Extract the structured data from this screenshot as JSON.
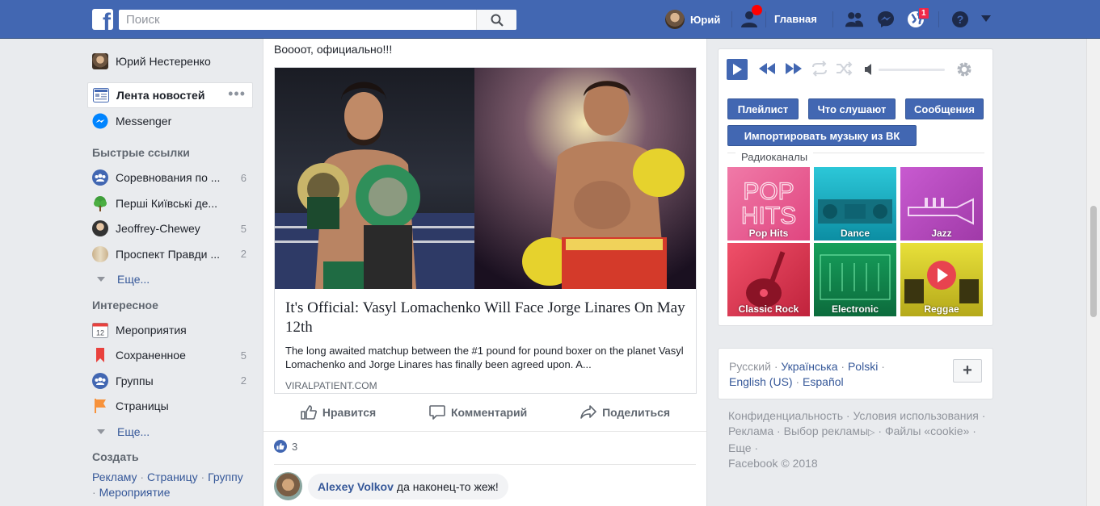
{
  "topbar": {
    "search_placeholder": "Поиск",
    "user_name": "Юрий",
    "home_label": "Главная",
    "notifications_count": "1",
    "brand_color": "#4267b2"
  },
  "leftnav": {
    "profile_name": "Юрий Нестеренко",
    "main_items": [
      {
        "label": "Лента новостей",
        "icon": "news-feed-icon",
        "active": true
      },
      {
        "label": "Messenger",
        "icon": "messenger-icon"
      }
    ],
    "quick_links_title": "Быстрые ссылки",
    "quick_links": [
      {
        "label": "Соревнования по ...",
        "count": "6",
        "icon": "group-icon"
      },
      {
        "label": "Перші Київські де...",
        "count": "",
        "icon": "tree-icon"
      },
      {
        "label": "Jeoffrey-Chewey",
        "count": "5",
        "icon": "avatar"
      },
      {
        "label": "Проспект Правди ...",
        "count": "2",
        "icon": "building-icon"
      }
    ],
    "more_label": "Еще...",
    "interesting_title": "Интересное",
    "interesting": [
      {
        "label": "Мероприятия",
        "count": "",
        "icon": "calendar-icon"
      },
      {
        "label": "Сохраненное",
        "count": "5",
        "icon": "bookmark-icon"
      },
      {
        "label": "Группы",
        "count": "2",
        "icon": "groups-icon"
      },
      {
        "label": "Страницы",
        "count": "",
        "icon": "flag-icon"
      }
    ],
    "more_label_2": "Еще...",
    "create_title": "Создать",
    "create_links": [
      "Рекламу",
      "Страницу",
      "Группу",
      "Мероприятие"
    ],
    "calendar_day": "12"
  },
  "post": {
    "text": "Воооот, официально!!!",
    "link_title": "It's Official: Vasyl Lomachenko Will Face Jorge Linares On May 12th",
    "link_desc": "The long awaited matchup between the #1 pound for pound boxer on the planet Vasyl Lomachenko and Jorge Linares has finally been agreed upon. A...",
    "link_domain": "VIRALPATIENT.COM",
    "actions": {
      "like": "Нравится",
      "comment": "Комментарий",
      "share": "Поделиться"
    },
    "likes_count": "3",
    "comment": {
      "author": "Alexey Volkov",
      "text": "да наконец-то жеж!"
    }
  },
  "music": {
    "buttons": {
      "playlist": "Плейлист",
      "listening": "Что слушают",
      "messages": "Сообщения",
      "import": "Импортировать музыку из ВК"
    },
    "radio_title": "Радиоканалы",
    "stations": [
      "Pop Hits",
      "Dance",
      "Jazz",
      "Classic Rock",
      "Electronic",
      "Reggae"
    ]
  },
  "languages": {
    "items": [
      "Русский",
      "Українська",
      "Polski",
      "English (US)",
      "Español"
    ],
    "plus": "+"
  },
  "footer": {
    "links": [
      "Конфиденциальность",
      "Условия использования",
      "Реклама",
      "Выбор рекламы",
      "Файлы «cookie»",
      "Еще"
    ],
    "copyright": "Facebook © 2018"
  }
}
